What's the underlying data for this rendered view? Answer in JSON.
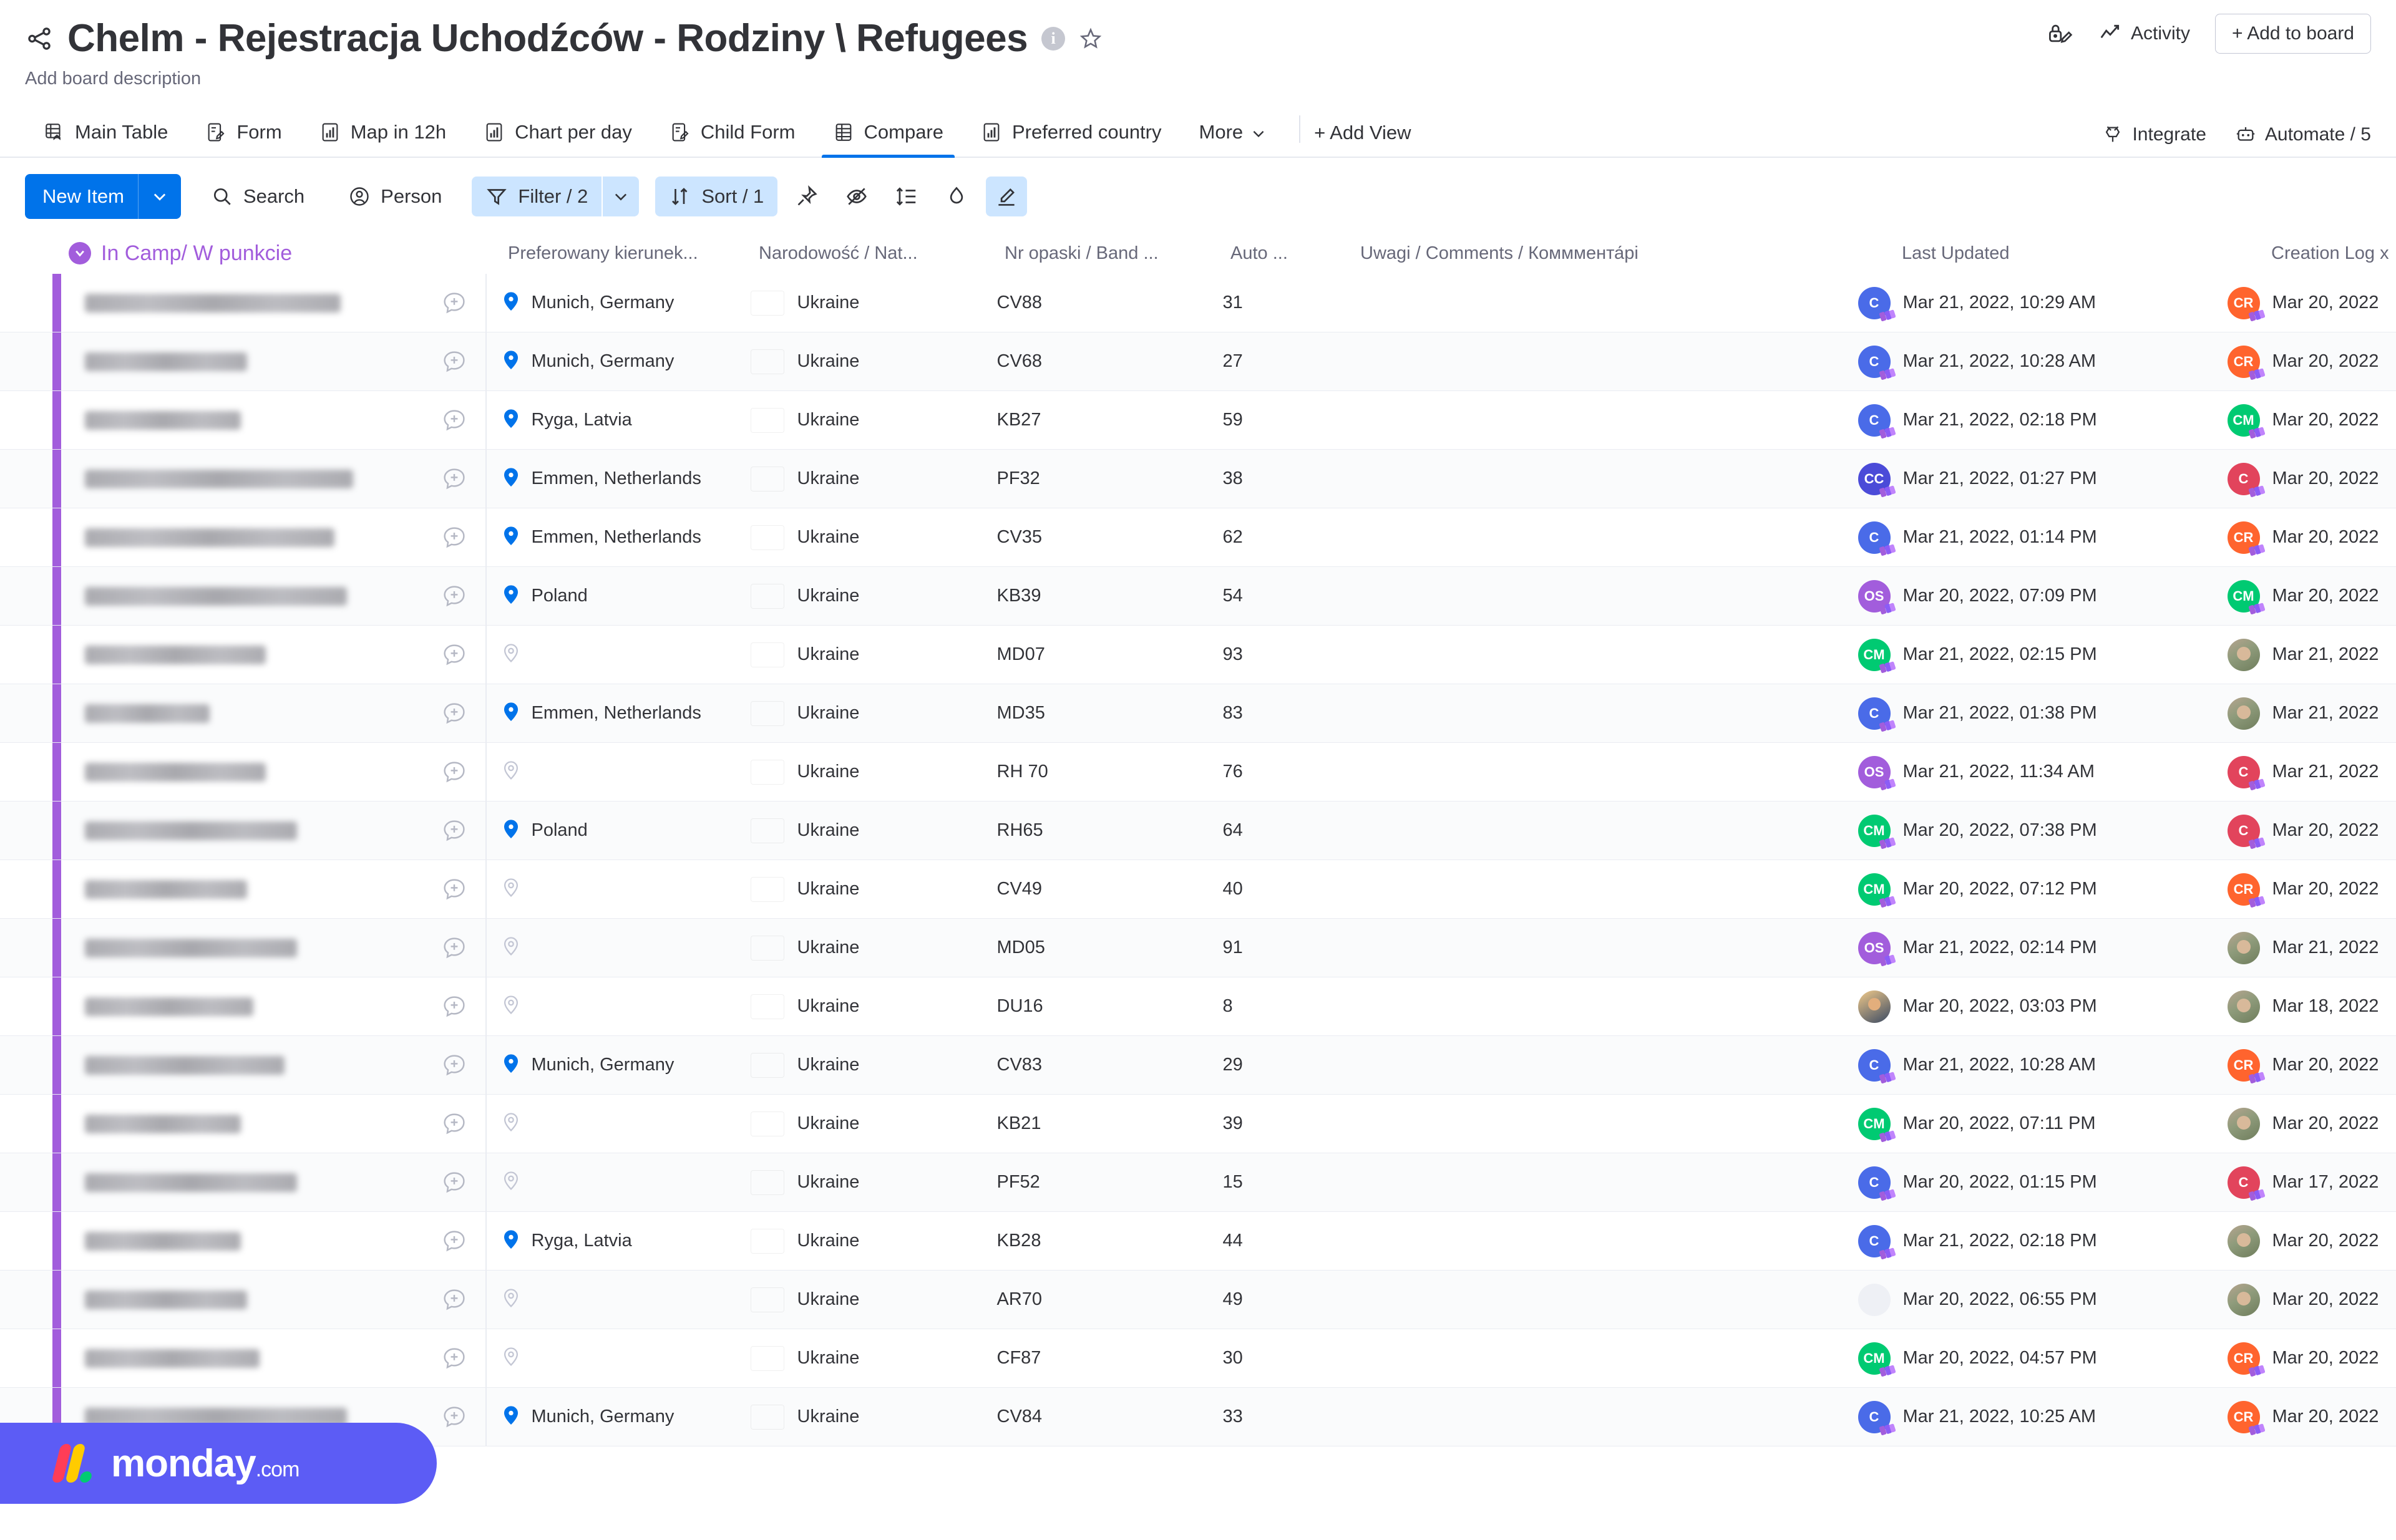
{
  "header": {
    "title": "Chelm - Rejestracja Uchodźców - Rodziny \\ Refugees",
    "info_badge": "i",
    "description": "Add board description",
    "activity_label": "Activity",
    "add_to_board_label": "+ Add to board"
  },
  "tabs": [
    {
      "label": "Main Table",
      "icon": "table-home-icon",
      "active": false
    },
    {
      "label": "Form",
      "icon": "form-icon",
      "active": false
    },
    {
      "label": "Map in 12h",
      "icon": "chart-icon",
      "active": false
    },
    {
      "label": "Chart per day",
      "icon": "chart-icon",
      "active": false
    },
    {
      "label": "Child Form",
      "icon": "form-icon",
      "active": false
    },
    {
      "label": "Compare",
      "icon": "table-icon",
      "active": true
    },
    {
      "label": "Preferred country",
      "icon": "chart-icon",
      "active": false
    },
    {
      "label": "More",
      "icon": "chevron-down-icon",
      "active": false
    }
  ],
  "add_view_label": "+ Add View",
  "tabs_right": {
    "integrate_label": "Integrate",
    "automate_label": "Automate / 5"
  },
  "toolbar": {
    "new_item_label": "New Item",
    "search_label": "Search",
    "person_label": "Person",
    "filter_label": "Filter / 2",
    "sort_label": "Sort / 1"
  },
  "columns": {
    "group": "In Camp/ W punkcie",
    "direction": "Preferowany kierunek...",
    "nationality": "Narodowość / Nat...",
    "band": "Nr opaski / Band ...",
    "auto": "Auto ...",
    "comments": "Uwagi / Comments / Комммента́рi",
    "last_updated": "Last Updated",
    "creation_log": "Creation Log x"
  },
  "rows": [
    {
      "name_w": 410,
      "direction": "Munich, Germany",
      "pin": "filled",
      "nationality": "Ukraine",
      "band": "CV88",
      "auto": "31",
      "upd_av": "C",
      "upd_cls": "a-blue",
      "updated": "Mar 21, 2022, 10:29 AM",
      "log_av": "CR",
      "log_cls": "a-orange",
      "created": "Mar 20, 2022"
    },
    {
      "name_w": 260,
      "direction": "Munich, Germany",
      "pin": "filled",
      "nationality": "Ukraine",
      "band": "CV68",
      "auto": "27",
      "upd_av": "C",
      "upd_cls": "a-blue",
      "updated": "Mar 21, 2022, 10:28 AM",
      "log_av": "CR",
      "log_cls": "a-orange",
      "created": "Mar 20, 2022"
    },
    {
      "name_w": 250,
      "direction": "Ryga, Latvia",
      "pin": "filled",
      "nationality": "Ukraine",
      "band": "KB27",
      "auto": "59",
      "upd_av": "C",
      "upd_cls": "a-blue",
      "updated": "Mar 21, 2022, 02:18 PM",
      "log_av": "CM",
      "log_cls": "a-green",
      "created": "Mar 20, 2022"
    },
    {
      "name_w": 430,
      "direction": "Emmen, Netherlands",
      "pin": "filled",
      "nationality": "Ukraine",
      "band": "PF32",
      "auto": "38",
      "upd_av": "CC",
      "upd_cls": "a-indigo",
      "updated": "Mar 21, 2022, 01:27 PM",
      "log_av": "C",
      "log_cls": "a-red",
      "created": "Mar 20, 2022"
    },
    {
      "name_w": 400,
      "direction": "Emmen, Netherlands",
      "pin": "filled",
      "nationality": "Ukraine",
      "band": "CV35",
      "auto": "62",
      "upd_av": "C",
      "upd_cls": "a-blue",
      "updated": "Mar 21, 2022, 01:14 PM",
      "log_av": "CR",
      "log_cls": "a-orange",
      "created": "Mar 20, 2022"
    },
    {
      "name_w": 420,
      "direction": "Poland",
      "pin": "filled",
      "nationality": "Ukraine",
      "band": "KB39",
      "auto": "54",
      "upd_av": "OS",
      "upd_cls": "a-purple",
      "updated": "Mar 20, 2022, 07:09 PM",
      "log_av": "CM",
      "log_cls": "a-green",
      "created": "Mar 20, 2022"
    },
    {
      "name_w": 290,
      "direction": "",
      "pin": "empty",
      "nationality": "Ukraine",
      "band": "MD07",
      "auto": "93",
      "upd_av": "CM",
      "upd_cls": "a-green",
      "updated": "Mar 21, 2022, 02:15 PM",
      "log_av": "",
      "log_cls": "photo",
      "created": "Mar 21, 2022"
    },
    {
      "name_w": 200,
      "direction": "Emmen, Netherlands",
      "pin": "filled",
      "nationality": "Ukraine",
      "band": "MD35",
      "auto": "83",
      "upd_av": "C",
      "upd_cls": "a-blue",
      "updated": "Mar 21, 2022, 01:38 PM",
      "log_av": "",
      "log_cls": "photo",
      "created": "Mar 21, 2022"
    },
    {
      "name_w": 290,
      "direction": "",
      "pin": "empty",
      "nationality": "Ukraine",
      "band": "RH 70",
      "auto": "76",
      "upd_av": "OS",
      "upd_cls": "a-purple",
      "updated": "Mar 21, 2022, 11:34 AM",
      "log_av": "C",
      "log_cls": "a-red",
      "created": "Mar 21, 2022"
    },
    {
      "name_w": 340,
      "direction": "Poland",
      "pin": "filled",
      "nationality": "Ukraine",
      "band": "RH65",
      "auto": "64",
      "upd_av": "CM",
      "upd_cls": "a-green",
      "updated": "Mar 20, 2022, 07:38 PM",
      "log_av": "C",
      "log_cls": "a-red",
      "created": "Mar 20, 2022"
    },
    {
      "name_w": 260,
      "direction": "",
      "pin": "empty",
      "nationality": "Ukraine",
      "band": "CV49",
      "auto": "40",
      "upd_av": "CM",
      "upd_cls": "a-green",
      "updated": "Mar 20, 2022, 07:12 PM",
      "log_av": "CR",
      "log_cls": "a-orange",
      "created": "Mar 20, 2022"
    },
    {
      "name_w": 340,
      "direction": "",
      "pin": "empty",
      "nationality": "Ukraine",
      "band": "MD05",
      "auto": "91",
      "upd_av": "OS",
      "upd_cls": "a-purple",
      "updated": "Mar 21, 2022, 02:14 PM",
      "log_av": "",
      "log_cls": "photo",
      "created": "Mar 21, 2022"
    },
    {
      "name_w": 270,
      "direction": "",
      "pin": "empty",
      "nationality": "Ukraine",
      "band": "DU16",
      "auto": "8",
      "upd_av": "",
      "upd_cls": "photo2",
      "updated": "Mar 20, 2022, 03:03 PM",
      "log_av": "",
      "log_cls": "photo",
      "created": "Mar 18, 2022"
    },
    {
      "name_w": 320,
      "direction": "Munich, Germany",
      "pin": "filled",
      "nationality": "Ukraine",
      "band": "CV83",
      "auto": "29",
      "upd_av": "C",
      "upd_cls": "a-blue",
      "updated": "Mar 21, 2022, 10:28 AM",
      "log_av": "CR",
      "log_cls": "a-orange",
      "created": "Mar 20, 2022"
    },
    {
      "name_w": 250,
      "direction": "",
      "pin": "empty",
      "nationality": "Ukraine",
      "band": "KB21",
      "auto": "39",
      "upd_av": "CM",
      "upd_cls": "a-green",
      "updated": "Mar 20, 2022, 07:11 PM",
      "log_av": "",
      "log_cls": "photo",
      "created": "Mar 20, 2022"
    },
    {
      "name_w": 340,
      "direction": "",
      "pin": "empty",
      "nationality": "Ukraine",
      "band": "PF52",
      "auto": "15",
      "upd_av": "C",
      "upd_cls": "a-blue",
      "updated": "Mar 20, 2022, 01:15 PM",
      "log_av": "C",
      "log_cls": "a-red",
      "created": "Mar 17, 2022"
    },
    {
      "name_w": 250,
      "direction": "Ryga, Latvia",
      "pin": "filled",
      "nationality": "Ukraine",
      "band": "KB28",
      "auto": "44",
      "upd_av": "C",
      "upd_cls": "a-blue",
      "updated": "Mar 21, 2022, 02:18 PM",
      "log_av": "",
      "log_cls": "photo",
      "created": "Mar 20, 2022"
    },
    {
      "name_w": 260,
      "direction": "",
      "pin": "empty",
      "nationality": "Ukraine",
      "band": "AR70",
      "auto": "49",
      "upd_av": "",
      "upd_cls": "photo3",
      "updated": "Mar 20, 2022, 06:55 PM",
      "log_av": "",
      "log_cls": "photo",
      "created": "Mar 20, 2022"
    },
    {
      "name_w": 280,
      "direction": "",
      "pin": "empty",
      "nationality": "Ukraine",
      "band": "CF87",
      "auto": "30",
      "upd_av": "CM",
      "upd_cls": "a-green",
      "updated": "Mar 20, 2022, 04:57 PM",
      "log_av": "CR",
      "log_cls": "a-orange",
      "created": "Mar 20, 2022"
    },
    {
      "name_w": 420,
      "direction": "Munich, Germany",
      "pin": "filled",
      "nationality": "Ukraine",
      "band": "CV84",
      "auto": "33",
      "upd_av": "C",
      "upd_cls": "a-blue",
      "updated": "Mar 21, 2022, 10:25 AM",
      "log_av": "CR",
      "log_cls": "a-orange",
      "created": "Mar 20, 2022"
    }
  ],
  "logo": {
    "text": "monday",
    "suffix": ".com"
  },
  "colors": {
    "accent": "#0073ea",
    "group": "#a25ddc",
    "brand": "#5c5cf5",
    "flag_top": "#0057b7",
    "flag_bottom": "#ffd700"
  }
}
